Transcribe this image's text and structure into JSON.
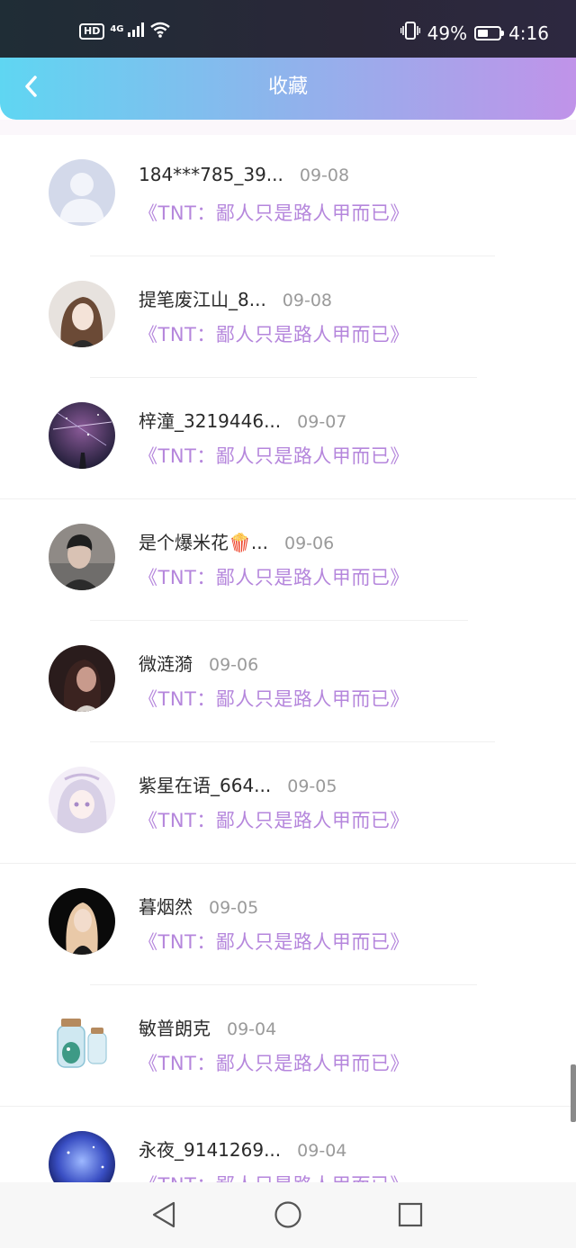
{
  "status_bar": {
    "hd": "HD",
    "network": "4G",
    "battery_percent": "49%",
    "battery_level": 0.49,
    "time": "4:16"
  },
  "header": {
    "title": "收藏",
    "back_icon": "chevron-left-icon",
    "gradient_start": "#5fd6f2",
    "gradient_end": "#c093e9"
  },
  "items": [
    {
      "name": "184***785_39...",
      "date": "09-08",
      "work": "《TNT：鄙人只是路人甲而已》",
      "avatar": "default-user"
    },
    {
      "name": "提笔废江山_8...",
      "date": "09-08",
      "work": "《TNT：鄙人只是路人甲而已》",
      "avatar": "anime-girl-brown-hair"
    },
    {
      "name": "梓潼_3219446...",
      "date": "09-07",
      "work": "《TNT：鄙人只是路人甲而已》",
      "avatar": "starry-night"
    },
    {
      "name": "是个爆米花🍿...",
      "date": "09-06",
      "work": "《TNT：鄙人只是路人甲而已》",
      "avatar": "man-portrait"
    },
    {
      "name": "微涟漪",
      "date": "09-06",
      "work": "《TNT：鄙人只是路人甲而已》",
      "avatar": "woman-dark-portrait"
    },
    {
      "name": "紫星在语_664...",
      "date": "09-05",
      "work": "《TNT：鄙人只是路人甲而已》",
      "avatar": "anime-girl-silver-hair"
    },
    {
      "name": "暮烟然",
      "date": "09-05",
      "work": "《TNT：鄙人只是路人甲而已》",
      "avatar": "woman-black-background"
    },
    {
      "name": "敏普朗克",
      "date": "09-04",
      "work": "《TNT：鄙人只是路人甲而已》",
      "avatar": "dinosaur-in-jar"
    },
    {
      "name": "永夜_9141269...",
      "date": "09-04",
      "work": "《TNT：鄙人只是路人甲而已》",
      "avatar": "blue-night-scene"
    }
  ],
  "colors": {
    "accent_text": "#b586dc",
    "name_text": "#2a2a2a",
    "date_text": "#9a9a9a"
  },
  "nav_bar": {
    "back": "triangle-back-icon",
    "home": "circle-home-icon",
    "recents": "square-recents-icon"
  }
}
